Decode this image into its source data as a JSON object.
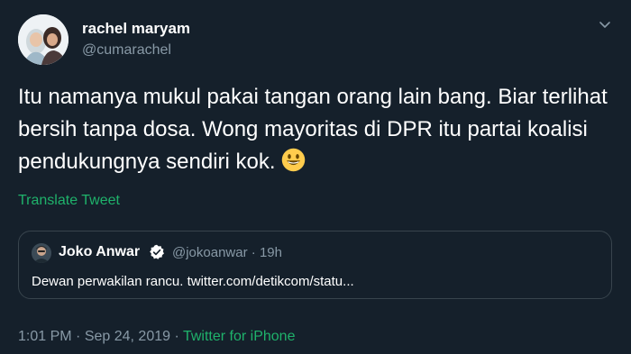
{
  "author": {
    "name": "rachel maryam",
    "handle": "@cumarachel"
  },
  "tweet": {
    "text": "Itu namanya mukul pakai tangan orang lain bang. Biar terlihat bersih tanpa dosa. Wong mayoritas di DPR itu partai koalisi pendukungnya sendiri kok.",
    "emoji": "grinning-face"
  },
  "translate_label": "Translate Tweet",
  "quoted": {
    "name": "Joko Anwar",
    "handle": "@jokoanwar",
    "separator": "·",
    "time": "19h",
    "text": "Dewan perwakilan rancu. twitter.com/detikcom/statu..."
  },
  "meta": {
    "time": "1:01 PM",
    "date": "Sep 24, 2019",
    "source": "Twitter for iPhone",
    "separator": "·"
  },
  "colors": {
    "background": "#15202b",
    "secondary_text": "#8899a6",
    "accent_green": "#1fb26b",
    "verified_blue": "#1da1f2"
  }
}
